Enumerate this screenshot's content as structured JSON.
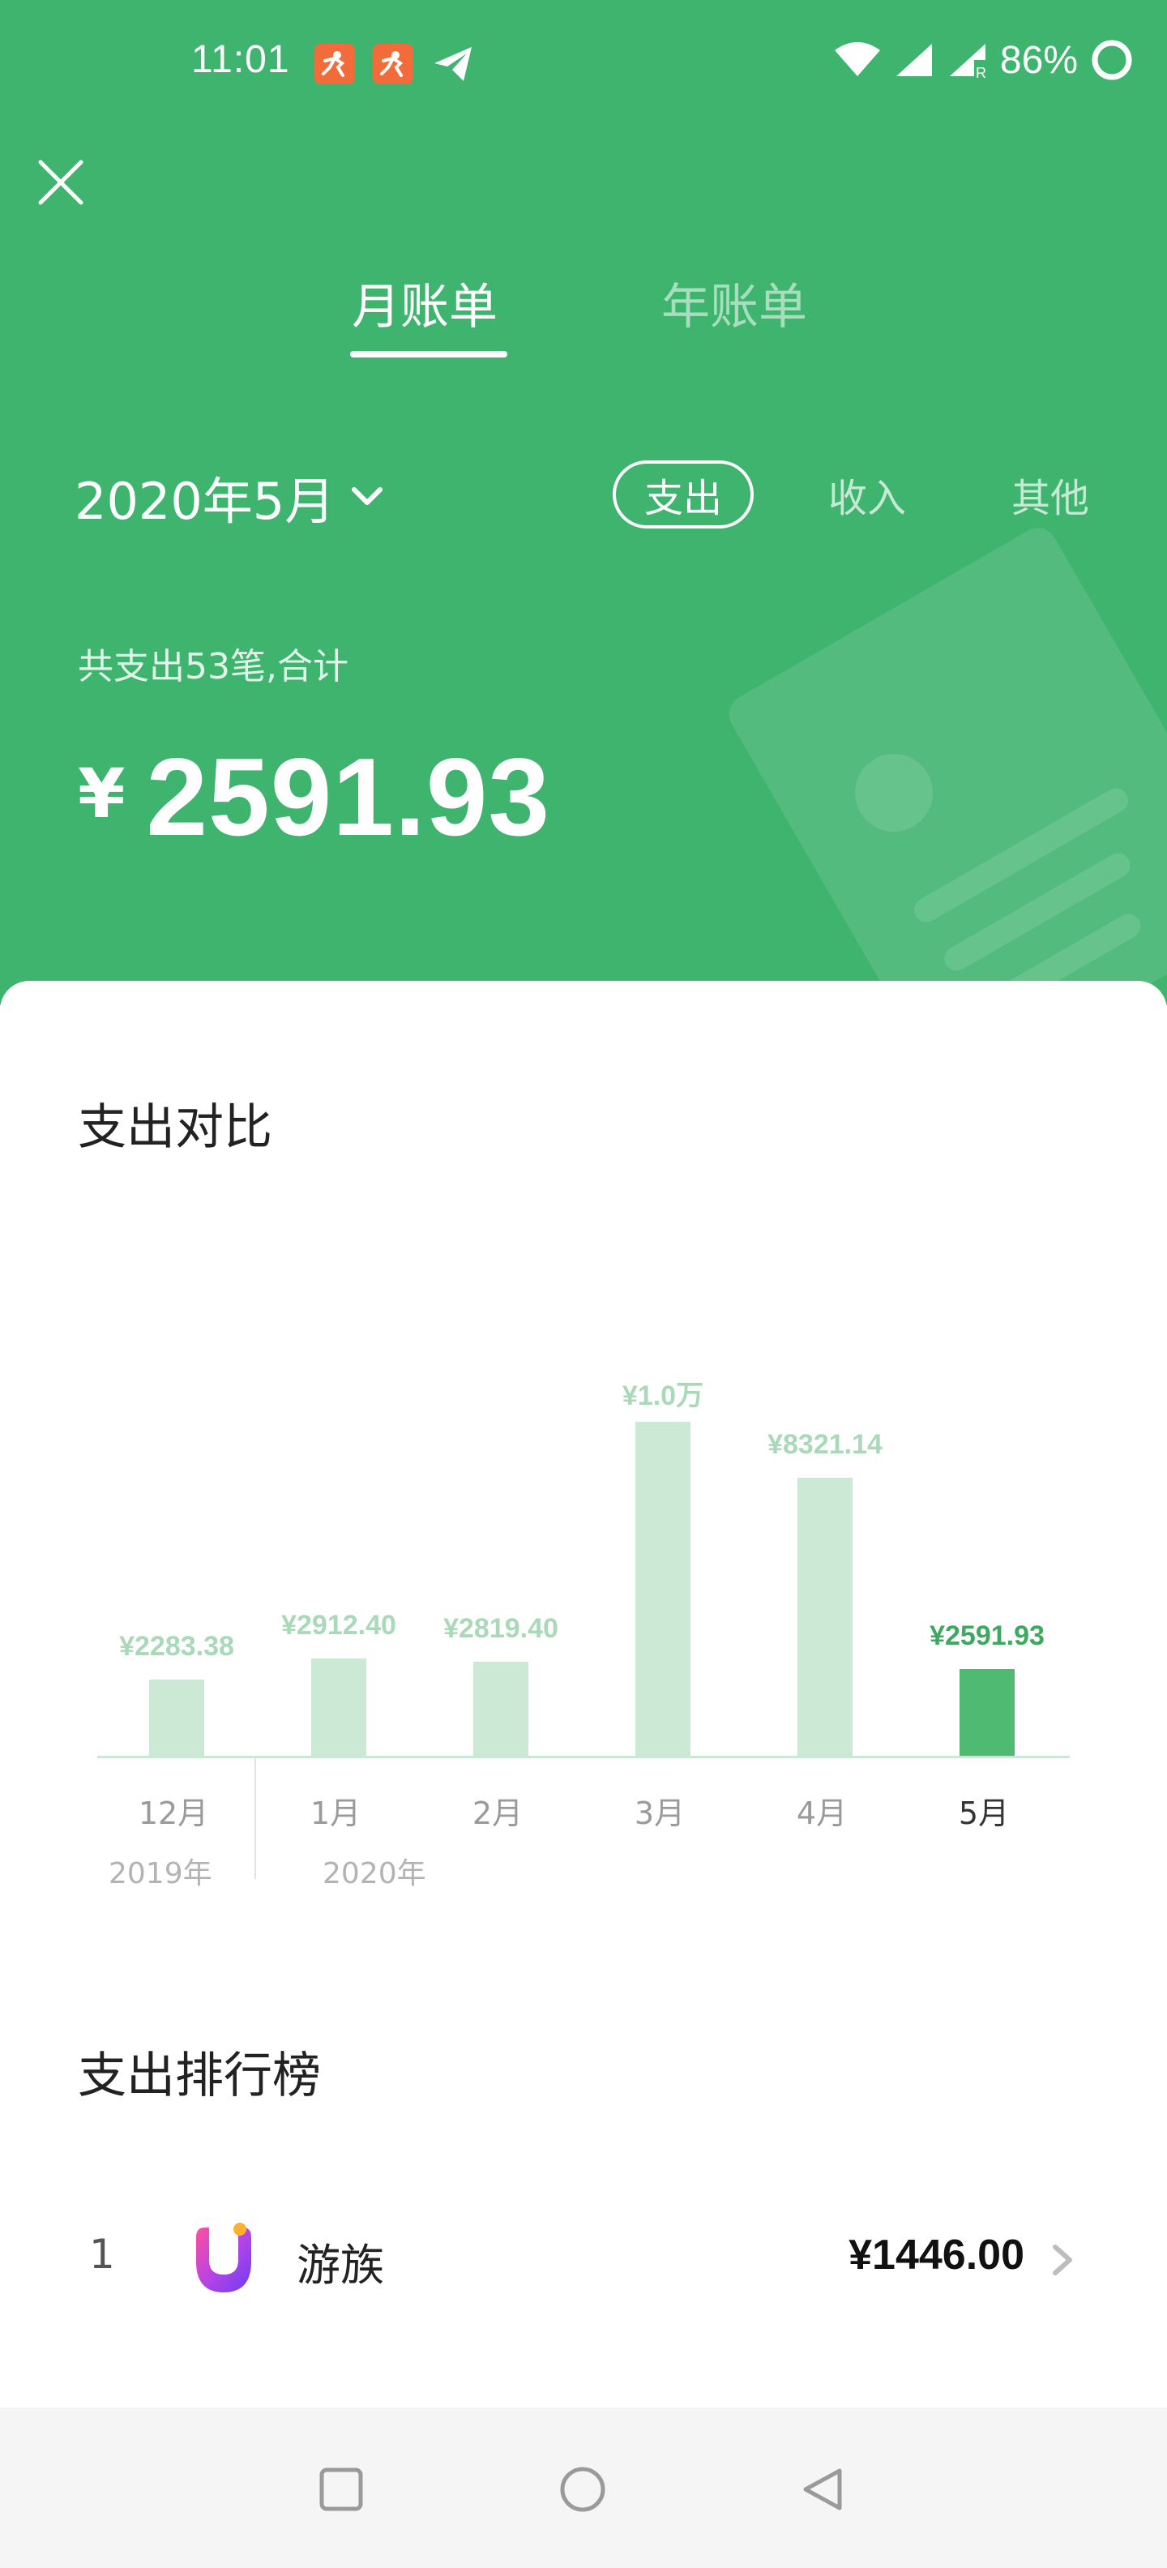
{
  "status_bar": {
    "time": "11:01",
    "battery": "86%",
    "icons": [
      "app-icon",
      "app-icon",
      "telegram-icon",
      "wifi-icon",
      "signal-icon",
      "signal-roaming-icon",
      "battery-ring-icon"
    ]
  },
  "tabs": [
    {
      "label": "月账单",
      "active": true
    },
    {
      "label": "年账单",
      "active": false
    }
  ],
  "period": {
    "label": "2020年5月"
  },
  "types": [
    {
      "label": "支出",
      "active": true
    },
    {
      "label": "收入",
      "active": false
    },
    {
      "label": "其他",
      "active": false
    }
  ],
  "summary": {
    "label": "共支出53笔,合计",
    "currency": "¥",
    "amount": "2591.93"
  },
  "compare_section": {
    "title": "支出对比"
  },
  "chart_data": {
    "type": "bar",
    "categories": [
      "12月",
      "1月",
      "2月",
      "3月",
      "4月",
      "5月"
    ],
    "values": [
      2283.38,
      2912.4,
      2819.4,
      10000,
      8321.14,
      2591.93
    ],
    "value_labels": [
      "¥2283.38",
      "¥2912.40",
      "¥2819.40",
      "¥1.0万",
      "¥8321.14",
      "¥2591.93"
    ],
    "year_labels": [
      "2019年",
      "2020年"
    ],
    "highlight_index": 5,
    "colors": {
      "bar": "#cce9d6",
      "highlight": "#4fbb72"
    }
  },
  "ranking_section": {
    "title": "支出排行榜",
    "items": [
      {
        "rank": "1",
        "name": "游族",
        "amount": "¥1446.00"
      }
    ]
  },
  "colors": {
    "primary": "#3fb46f",
    "accent_text": "#3da860"
  }
}
